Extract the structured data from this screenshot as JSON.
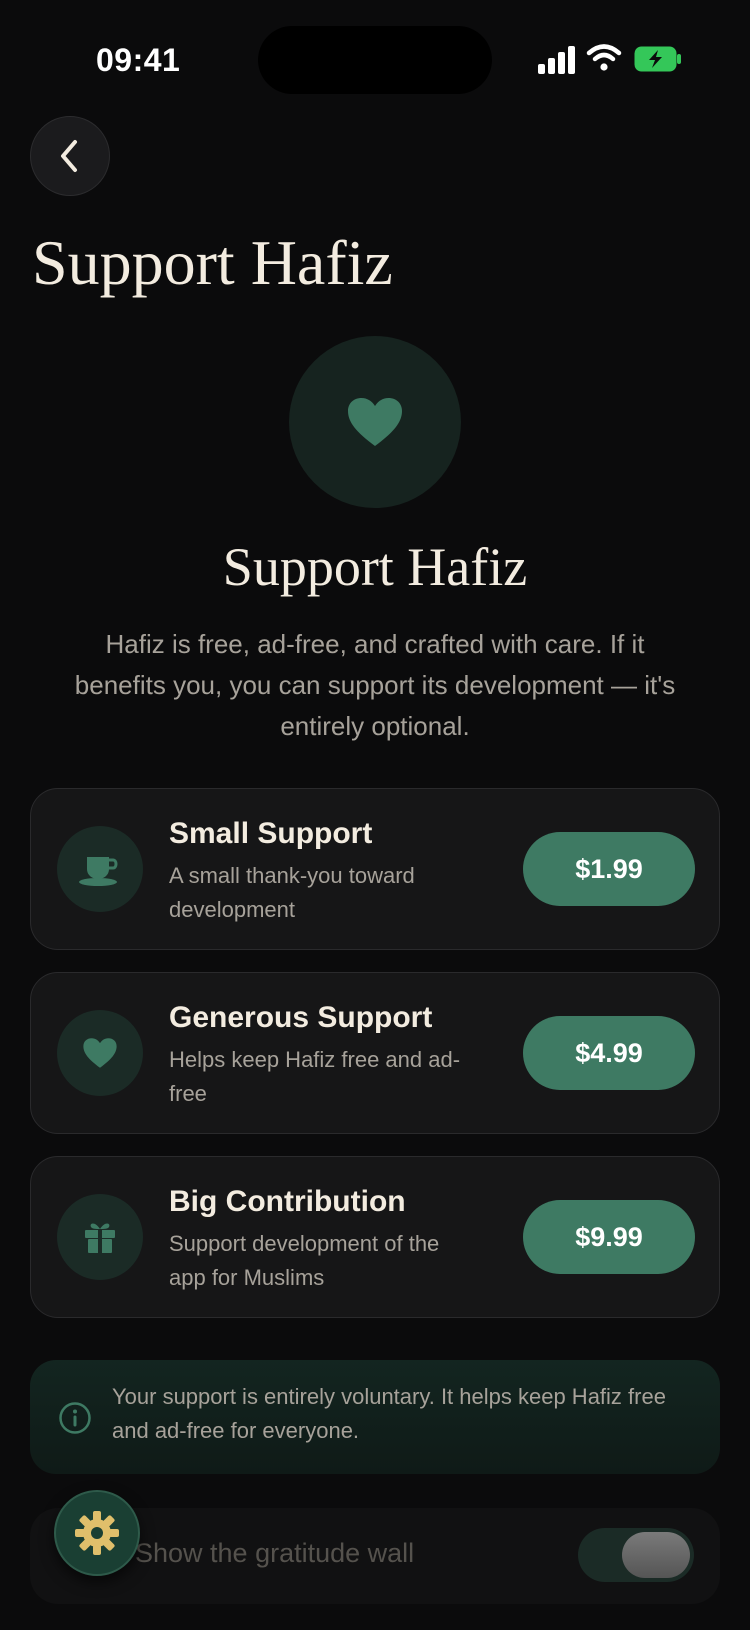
{
  "status_bar": {
    "time": "09:41"
  },
  "header": {
    "title": "Support Hafiz",
    "back_icon": "chevron-left-icon"
  },
  "hero": {
    "icon": "heart-icon",
    "title": "Support Hafiz",
    "description": "Hafiz is free, ad-free, and crafted with care. If it benefits you, you can support its development — it's entirely optional."
  },
  "options": [
    {
      "icon": "coffee-cup-icon",
      "title": "Small Support",
      "subtitle": "A small thank-you toward development",
      "price": "$1.99"
    },
    {
      "icon": "heart-icon",
      "title": "Generous Support",
      "subtitle": "Helps keep Hafiz free and ad-free",
      "price": "$4.99"
    },
    {
      "icon": "gift-icon",
      "title": "Big Contribution",
      "subtitle": "Support development of the app for Muslims",
      "price": "$9.99"
    }
  ],
  "note": {
    "icon": "info-icon",
    "text": "Your support is entirely voluntary. It helps keep Hafiz free and ad-free for everyone."
  },
  "toggle": {
    "label": "Show the gratitude wall"
  },
  "fab": {
    "icon": "gear-icon"
  },
  "colors": {
    "accent": "#3e7a63",
    "background": "#0b0b0c",
    "text": "#f3ece0",
    "muted": "#a7a29a"
  }
}
